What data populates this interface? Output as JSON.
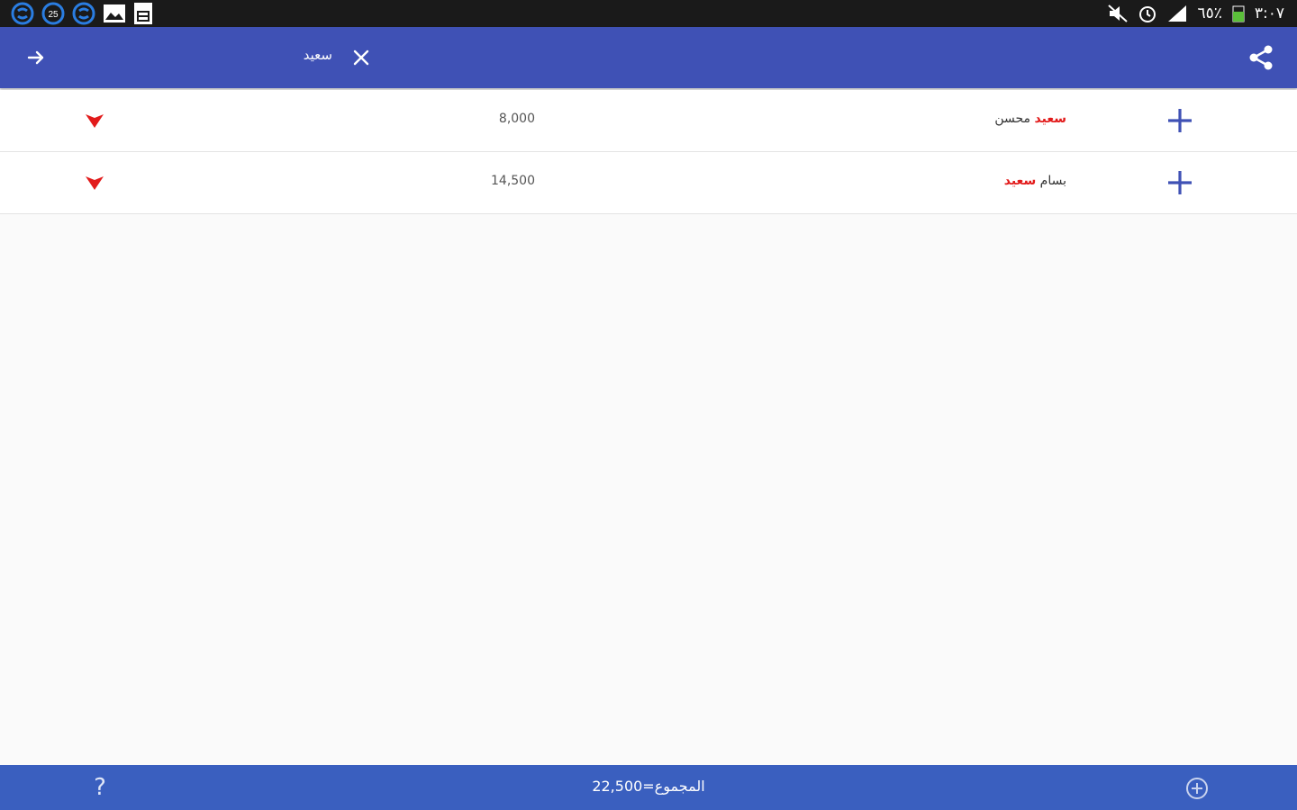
{
  "status_bar": {
    "left_icons": [
      "skype-icon",
      "notification-count-icon",
      "skype-icon",
      "image-icon",
      "document-icon"
    ],
    "notification_count": "25",
    "battery_percent": "٦٥٪",
    "time": "٣:٠٧"
  },
  "app_bar": {
    "search_query": "سعيد",
    "color": "#3f51b5"
  },
  "results": [
    {
      "name_highlight": "سعيد",
      "name_rest": "محسن",
      "amount": "8,000"
    },
    {
      "name_highlight": "سعيد",
      "name_rest": "بسام",
      "amount": "14,500"
    }
  ],
  "bottom_bar": {
    "help_label": "?",
    "total_label": "المجموع=",
    "total_value": "22,500",
    "color": "#3a5fbf"
  },
  "colors": {
    "highlight": "#e21b1b",
    "add_icon": "#3f51b5"
  }
}
